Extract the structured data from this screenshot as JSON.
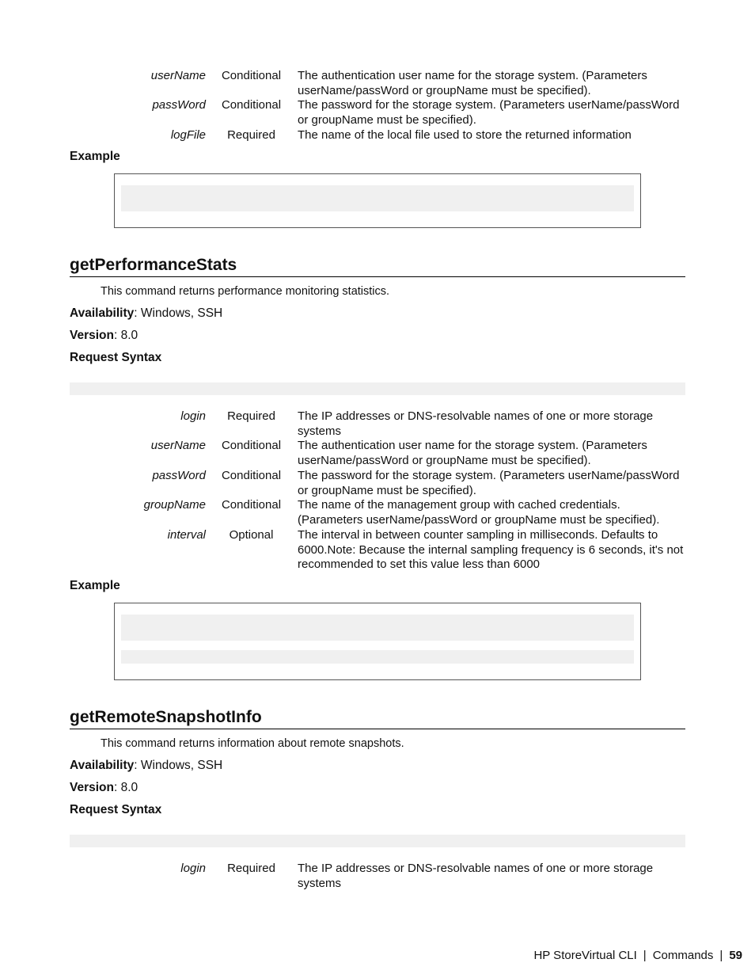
{
  "top_params": [
    {
      "name": "userName",
      "req": "Conditional",
      "desc": "The authentication user name for the storage system. (Parameters userName/passWord or groupName must be specified)."
    },
    {
      "name": "passWord",
      "req": "Conditional",
      "desc": "The password for the storage system. (Parameters userName/passWord or groupName must be specified)."
    },
    {
      "name": "logFile",
      "req": "Required",
      "desc": "The name of the local file used to store the returned information"
    }
  ],
  "top_example_label": "Example",
  "sections": [
    {
      "title": "getPerformanceStats",
      "description": "This command returns performance monitoring statistics.",
      "availability_label": "Availability",
      "availability": ": Windows, SSH",
      "version_label": "Version",
      "version": ": 8.0",
      "request_syntax_label": "Request Syntax",
      "params": [
        {
          "name": "login",
          "req": "Required",
          "desc": "The IP addresses or DNS-resolvable names of one or more storage systems"
        },
        {
          "name": "userName",
          "req": "Conditional",
          "desc": "The authentication user name for the storage system. (Parameters userName/passWord or groupName must be specified)."
        },
        {
          "name": "passWord",
          "req": "Conditional",
          "desc": "The password for the storage system. (Parameters userName/passWord or groupName must be specified)."
        },
        {
          "name": "groupName",
          "req": "Conditional",
          "desc": "The name of the management group with cached credentials. (Parameters userName/passWord or groupName must be specified)."
        },
        {
          "name": "interval",
          "req": "Optional",
          "desc": "The interval in between counter sampling in milliseconds. Defaults to 6000.Note: Because the internal sampling frequency is 6 seconds, it's not recommended to set this value less than 6000"
        }
      ],
      "example_label": "Example"
    },
    {
      "title": "getRemoteSnapshotInfo",
      "description": "This command returns information about remote snapshots.",
      "availability_label": "Availability",
      "availability": ": Windows, SSH",
      "version_label": "Version",
      "version": ": 8.0",
      "request_syntax_label": "Request Syntax",
      "params": [
        {
          "name": "login",
          "req": "Required",
          "desc": "The IP addresses or DNS-resolvable names of one or more storage systems"
        }
      ]
    }
  ],
  "footer": {
    "product": "HP StoreVirtual CLI",
    "chapter": "Commands",
    "separator": "|",
    "page_number": "59"
  }
}
